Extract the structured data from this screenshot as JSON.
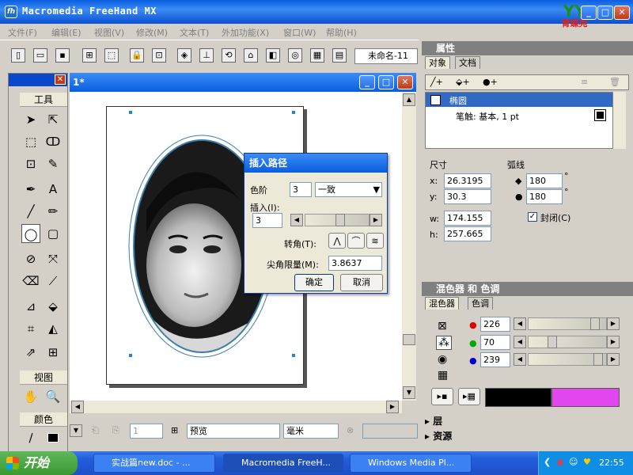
{
  "window": {
    "title": "Macromedia FreeHand MX",
    "logo_text": "YY",
    "logo_sub": "青蝶苑"
  },
  "menu": [
    "文件(F)",
    "编辑(E)",
    "视图(V)",
    "修改(M)",
    "文本(T)",
    "外加功能(X)",
    "窗口(W)",
    "帮助(H)"
  ],
  "toolbar": {
    "doc_select": "未命名-11"
  },
  "tools": {
    "title": "工具",
    "view_title": "视图",
    "color_title": "颜色"
  },
  "document": {
    "tab_label": "1*"
  },
  "status": {
    "page_num": "1",
    "preview": "预览",
    "units": "毫米"
  },
  "dialog": {
    "title": "插入路径",
    "steps_label": "色阶",
    "steps_value": "3",
    "steps_mode": "一致",
    "insert_label": "插入(I):",
    "insert_value": "3",
    "corner_label": "转角(T):",
    "miter_label": "尖角限量(M):",
    "miter_value": "3.8637",
    "ok": "确定",
    "cancel": "取消"
  },
  "properties": {
    "title": "属性",
    "tabs": [
      "对象",
      "文档"
    ],
    "items": [
      {
        "label": "椭圆"
      },
      {
        "label": "笔触: 基本, 1 pt"
      }
    ],
    "size_title": "尺寸",
    "arc_title": "弧线",
    "x_label": "x:",
    "x_value": "26.3195",
    "y_label": "y:",
    "y_value": "30.3",
    "w_label": "w:",
    "w_value": "174.155",
    "h_label": "h:",
    "h_value": "257.665",
    "arc1": "180",
    "arc2": "180",
    "deg": "°",
    "closed_label": "封闭(C)"
  },
  "mixer": {
    "title": "混色器 和 色调",
    "tabs": [
      "混色器",
      "色调"
    ],
    "r": "226",
    "g": "70",
    "b": "239",
    "r_level": 0.886,
    "g_level": 0.275,
    "b_level": 0.937,
    "swatch_prev": "#000000",
    "swatch_cur": "#e246ef"
  },
  "layers": {
    "title": "层"
  },
  "library": {
    "title": "资源"
  },
  "taskbar": {
    "start": "开始",
    "tasks": [
      "实战篇new.doc - ...",
      "Macromedia FreeH...",
      "Windows Media Pl..."
    ],
    "time": "22:55"
  },
  "colors": {
    "title_blue": "#0a5ee0",
    "accent_pink": "#e246ef",
    "taskbar": "#245edb"
  }
}
